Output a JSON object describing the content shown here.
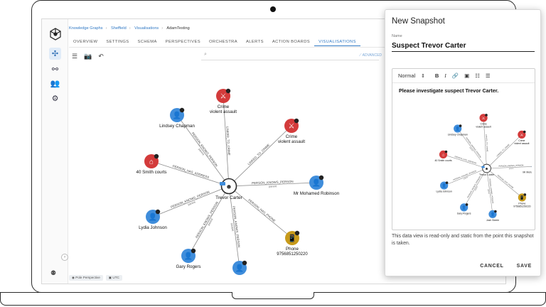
{
  "app": {
    "breadcrumbs": [
      "Knowledge Graphs",
      "Sheffield",
      "Visualisations",
      "AdamTesting"
    ],
    "tabs": [
      {
        "label": "OVERVIEW",
        "active": false
      },
      {
        "label": "SETTINGS",
        "active": false
      },
      {
        "label": "SCHEMA",
        "active": false
      },
      {
        "label": "PERSPECTIVES",
        "active": false
      },
      {
        "label": "ORCHESTRA",
        "active": false
      },
      {
        "label": "ALERTS",
        "active": false
      },
      {
        "label": "ACTION BOARDS",
        "active": false
      },
      {
        "label": "VISUALISATIONS",
        "active": true
      }
    ],
    "advanced_label": "ADVANCED",
    "status_chips": [
      "Pole Perspective",
      "UTC"
    ]
  },
  "graph": {
    "colors": {
      "person": "#3f8ddb",
      "crime": "#d33b3b",
      "address": "#d33b3b",
      "phone": "#c79a1a",
      "center": "#2a2a2a",
      "edge": "#8a8a8a"
    },
    "center": {
      "id": "trevor",
      "label": "Trevor Carter"
    },
    "nodes": [
      {
        "id": "crime1",
        "type": "crime",
        "label": "Crime",
        "sublabel": "violent assault"
      },
      {
        "id": "crime2",
        "type": "crime",
        "label": "Crime",
        "sublabel": "violent assault"
      },
      {
        "id": "lindsey",
        "type": "person",
        "label": "Lindsey Chapman",
        "sublabel": ""
      },
      {
        "id": "address",
        "type": "address",
        "label": "40 Smith courts",
        "sublabel": ""
      },
      {
        "id": "mohamed",
        "type": "person",
        "label": "Mr Mohamed Robinson",
        "sublabel": ""
      },
      {
        "id": "lydia",
        "type": "person",
        "label": "Lydia Johnson",
        "sublabel": ""
      },
      {
        "id": "phone",
        "type": "phone",
        "label": "Phone",
        "sublabel": "97568512502​20"
      },
      {
        "id": "gary",
        "type": "person",
        "label": "Gary Rogers",
        "sublabel": ""
      },
      {
        "id": "josh",
        "type": "person",
        "label": "Josh Steele",
        "sublabel": ""
      }
    ],
    "edges": [
      {
        "to": "crime1",
        "label": "LINKED_TO_CRIME"
      },
      {
        "to": "crime2",
        "label": "LINKED_TO_CRIME"
      },
      {
        "to": "lindsey",
        "label": "PERSON_KNOWS_PERSON",
        "sub": "parent"
      },
      {
        "to": "address",
        "label": "PERSON_HAS_ADDRESS"
      },
      {
        "to": "mohamed",
        "label": "PERSON_KNOWS_PERSON",
        "sub": "parent"
      },
      {
        "to": "lydia",
        "label": "PERSON_KNOWS_PERSON",
        "sub": "parent"
      },
      {
        "to": "phone",
        "label": "PERSON_HAS_PHONE"
      },
      {
        "to": "gary",
        "label": "PERSON_KNOWS_PERSON",
        "sub": "parent"
      },
      {
        "to": "josh",
        "label": "PERSON_KNOWS_PERSON",
        "sub": "parent"
      }
    ]
  },
  "dialog": {
    "title": "New Snapshot",
    "name_label": "Name",
    "name_value": "Suspect Trevor Carter",
    "format_label": "Normal",
    "body_text": "Please investigate suspect Trevor Carter.",
    "note": "This data view is read-only and static from the point this snapshot is taken.",
    "cancel_label": "CANCEL",
    "save_label": "SAVE"
  }
}
